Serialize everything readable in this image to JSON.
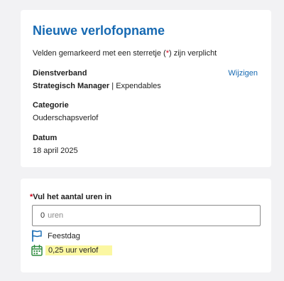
{
  "card1": {
    "title": "Nieuwe verlofopname",
    "hint_before": "Velden gemarkeerd met een sterretje (",
    "hint_star": "*",
    "hint_after": ") zijn verplicht",
    "employment": {
      "label": "Dienstverband",
      "change_link": "Wijzigen",
      "role": "Strategisch Manager",
      "separator": " | ",
      "company": "Expendables"
    },
    "category": {
      "label": "Categorie",
      "value": "Ouderschapsverlof"
    },
    "date": {
      "label": "Datum",
      "value": "18 april 2025"
    }
  },
  "card2": {
    "hours_label_star": "*",
    "hours_label": "Vul het aantal uren in",
    "hours_input": {
      "value": "0",
      "unit": "uren"
    },
    "holiday": {
      "icon": "flag-icon",
      "text": "Feestdag"
    },
    "leave": {
      "icon": "calendar-icon",
      "text": "0,25 uur verlof",
      "highlight_color": "#fbf7a2"
    }
  },
  "colors": {
    "accent": "#1669b2",
    "required": "#d0021b",
    "icon_green": "#2e8b3e"
  }
}
